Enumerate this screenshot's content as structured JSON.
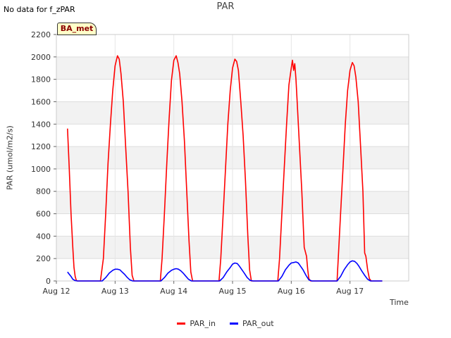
{
  "note": "No data for f_zPAR",
  "chart_data": {
    "type": "line",
    "title": "PAR",
    "badge": "BA_met",
    "xlabel": "Time",
    "ylabel": "PAR (umol/m2/s)",
    "ylim": [
      0,
      2200
    ],
    "yticks": [
      0,
      200,
      400,
      600,
      800,
      1000,
      1200,
      1400,
      1600,
      1800,
      2000,
      2200
    ],
    "xlim": [
      0,
      6
    ],
    "xticks": [
      0,
      1,
      2,
      3,
      4,
      5
    ],
    "xtick_labels": [
      "Aug 12",
      "Aug 13",
      "Aug 14",
      "Aug 15",
      "Aug 16",
      "Aug 17"
    ],
    "grid": true,
    "legend_position": "bottom",
    "series": [
      {
        "name": "PAR_in",
        "color": "#ff0000",
        "x": [
          0.19,
          0.22,
          0.25,
          0.28,
          0.3,
          0.32,
          0.34,
          0.36,
          0.4,
          0.6,
          0.75,
          0.8,
          0.84,
          0.88,
          0.92,
          0.96,
          1.0,
          1.04,
          1.07,
          1.1,
          1.14,
          1.18,
          1.22,
          1.26,
          1.29,
          1.32,
          1.35,
          1.4,
          1.6,
          1.77,
          1.8,
          1.84,
          1.88,
          1.92,
          1.96,
          2.0,
          2.04,
          2.07,
          2.1,
          2.14,
          2.18,
          2.22,
          2.26,
          2.29,
          2.32,
          2.35,
          2.4,
          2.6,
          2.77,
          2.8,
          2.84,
          2.88,
          2.92,
          2.96,
          3.0,
          3.04,
          3.07,
          3.1,
          3.14,
          3.18,
          3.22,
          3.26,
          3.29,
          3.32,
          3.35,
          3.4,
          3.6,
          3.77,
          3.8,
          3.84,
          3.88,
          3.92,
          3.96,
          4.0,
          4.02,
          4.04,
          4.06,
          4.08,
          4.1,
          4.14,
          4.18,
          4.22,
          4.26,
          4.28,
          4.3,
          4.33,
          4.36,
          4.4,
          4.6,
          4.78,
          4.8,
          4.84,
          4.88,
          4.92,
          4.96,
          5.0,
          5.04,
          5.07,
          5.1,
          5.14,
          5.18,
          5.22,
          5.25,
          5.27,
          5.3,
          5.33,
          5.36,
          5.4,
          5.55
        ],
        "values": [
          1360,
          1000,
          600,
          300,
          120,
          40,
          5,
          0,
          0,
          0,
          0,
          200,
          600,
          1050,
          1400,
          1700,
          1920,
          2010,
          1980,
          1850,
          1600,
          1200,
          800,
          300,
          50,
          0,
          0,
          0,
          0,
          0,
          200,
          600,
          1050,
          1450,
          1790,
          1970,
          2010,
          1950,
          1850,
          1600,
          1250,
          800,
          350,
          80,
          0,
          0,
          0,
          0,
          0,
          200,
          600,
          1000,
          1400,
          1700,
          1900,
          1980,
          1960,
          1880,
          1600,
          1300,
          900,
          400,
          100,
          0,
          0,
          0,
          0,
          0,
          200,
          600,
          1000,
          1400,
          1750,
          1900,
          1970,
          1880,
          1940,
          1800,
          1600,
          1200,
          800,
          300,
          220,
          100,
          20,
          0,
          0,
          0,
          0,
          0,
          200,
          600,
          1000,
          1400,
          1700,
          1880,
          1950,
          1920,
          1820,
          1600,
          1200,
          800,
          250,
          220,
          100,
          20,
          0,
          0,
          0
        ]
      },
      {
        "name": "PAR_out",
        "color": "#0000ff",
        "x": [
          0.19,
          0.22,
          0.25,
          0.28,
          0.32,
          0.36,
          0.4,
          0.6,
          0.78,
          0.84,
          0.9,
          0.96,
          1.0,
          1.04,
          1.08,
          1.12,
          1.16,
          1.2,
          1.25,
          1.3,
          1.35,
          1.4,
          1.6,
          1.78,
          1.84,
          1.9,
          1.96,
          2.0,
          2.04,
          2.08,
          2.12,
          2.16,
          2.2,
          2.25,
          2.3,
          2.35,
          2.4,
          2.6,
          2.78,
          2.84,
          2.9,
          2.96,
          3.0,
          3.04,
          3.08,
          3.12,
          3.16,
          3.2,
          3.25,
          3.3,
          3.35,
          3.4,
          3.6,
          3.78,
          3.84,
          3.9,
          3.96,
          4.0,
          4.04,
          4.08,
          4.12,
          4.16,
          4.2,
          4.25,
          4.3,
          4.35,
          4.4,
          4.6,
          4.78,
          4.84,
          4.9,
          4.96,
          5.0,
          5.04,
          5.08,
          5.12,
          5.16,
          5.2,
          5.25,
          5.3,
          5.35,
          5.4,
          5.55
        ],
        "values": [
          80,
          60,
          40,
          15,
          3,
          0,
          0,
          0,
          0,
          30,
          70,
          95,
          105,
          105,
          100,
          80,
          60,
          35,
          10,
          0,
          0,
          0,
          0,
          0,
          30,
          70,
          95,
          105,
          110,
          105,
          90,
          70,
          45,
          15,
          0,
          0,
          0,
          0,
          0,
          30,
          80,
          120,
          150,
          160,
          155,
          130,
          100,
          70,
          30,
          5,
          0,
          0,
          0,
          0,
          40,
          100,
          140,
          160,
          165,
          170,
          160,
          130,
          100,
          50,
          10,
          0,
          0,
          0,
          0,
          40,
          100,
          145,
          170,
          180,
          175,
          155,
          125,
          90,
          50,
          15,
          0,
          0,
          0
        ]
      }
    ]
  }
}
